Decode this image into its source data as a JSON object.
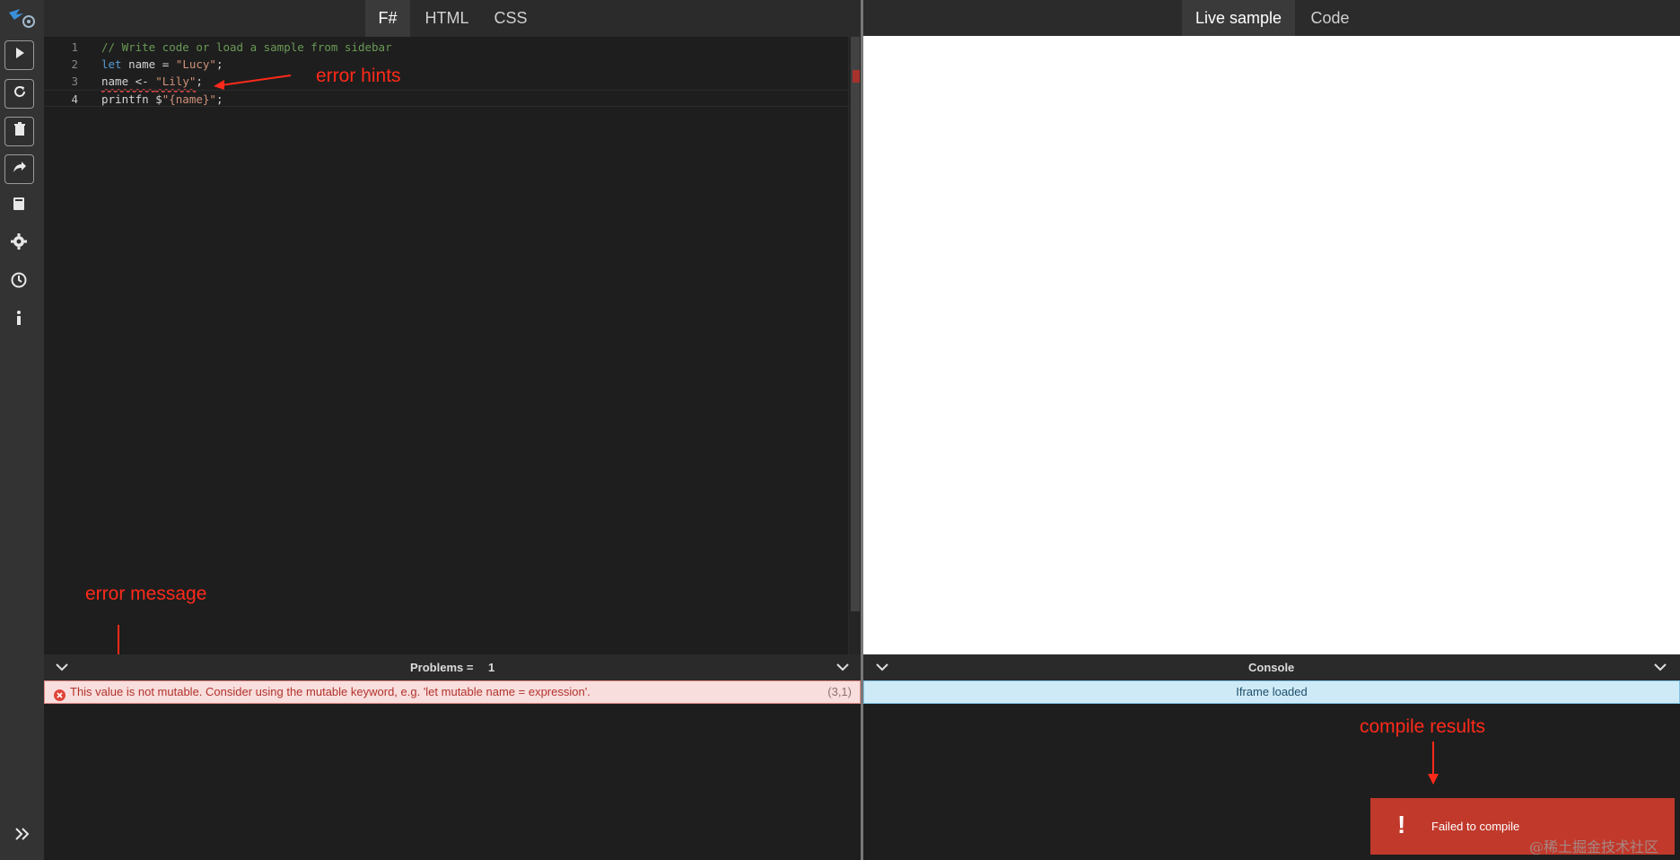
{
  "editor": {
    "tabs": [
      {
        "label": "F#",
        "active": true
      },
      {
        "label": "HTML",
        "active": false
      },
      {
        "label": "CSS",
        "active": false
      }
    ],
    "lines": [
      {
        "num": "1",
        "tokens": [
          {
            "text": "// Write code or load a sample from sidebar",
            "kind": "comment"
          }
        ]
      },
      {
        "num": "2",
        "tokens": [
          {
            "text": "let",
            "kind": "kw"
          },
          {
            "text": " name = ",
            "kind": "plain"
          },
          {
            "text": "\"Lucy\"",
            "kind": "str"
          },
          {
            "text": ";",
            "kind": "plain"
          }
        ]
      },
      {
        "num": "3",
        "tokens": [
          {
            "text": "name <- ",
            "kind": "plain",
            "error": true
          },
          {
            "text": "\"Lily\"",
            "kind": "str",
            "error": true
          },
          {
            "text": ";",
            "kind": "plain"
          }
        ]
      },
      {
        "num": "4",
        "tokens": [
          {
            "text": "printfn $",
            "kind": "plain"
          },
          {
            "text": "\"{name}\"",
            "kind": "str"
          },
          {
            "text": ";",
            "kind": "plain"
          }
        ],
        "current": true
      }
    ]
  },
  "annotations": {
    "error_hints": "error hints",
    "error_message": "error message",
    "compile_results": "compile results"
  },
  "problems": {
    "title": "Problems =",
    "count": "1",
    "message": "This value is not mutable. Consider using the mutable keyword, e.g. 'let mutable name = expression'.",
    "location": "(3,1)"
  },
  "preview": {
    "tabs": [
      {
        "label": "Live sample",
        "active": true
      },
      {
        "label": "Code",
        "active": false
      }
    ]
  },
  "console": {
    "title": "Console",
    "message": "Iframe loaded"
  },
  "toast": {
    "icon": "!",
    "message": "Failed to compile"
  },
  "watermark": "@稀土掘金技术社区",
  "colors": {
    "error_text": "#b2332d",
    "error_bg": "#f8dedd",
    "console_bg": "#cfeaf7",
    "toast_bg": "#c0392b",
    "annotation": "#ff2a1a"
  },
  "sidebar": {
    "icons": [
      "play-icon",
      "refresh-icon",
      "trash-icon",
      "share-icon",
      "book-icon",
      "gear-icon",
      "clock-icon",
      "info-icon",
      "expand-icon"
    ]
  }
}
